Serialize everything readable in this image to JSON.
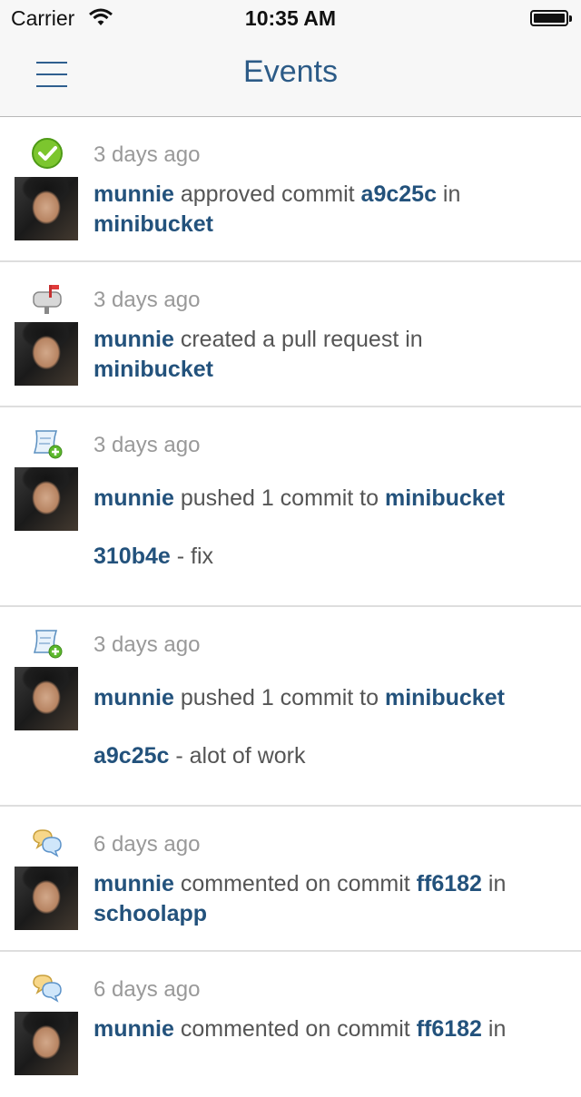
{
  "status_bar": {
    "carrier": "Carrier",
    "time": "10:35 AM"
  },
  "nav": {
    "title": "Events"
  },
  "events": [
    {
      "icon": "checkmark-icon",
      "time": "3 days ago",
      "user": "munnie",
      "action": " approved commit ",
      "target": "a9c25c",
      "joiner": " in",
      "repo": "minibucket"
    },
    {
      "icon": "mailbox-icon",
      "time": "3 days ago",
      "user": "munnie",
      "action": " created a pull request in",
      "repo": "minibucket"
    },
    {
      "icon": "scroll-add-icon",
      "time": "3 days ago",
      "user": "munnie",
      "action": " pushed 1 commit to ",
      "repo": "minibucket",
      "commit_hash": "310b4e",
      "commit_msg": " - fix"
    },
    {
      "icon": "scroll-add-icon",
      "time": "3 days ago",
      "user": "munnie",
      "action": " pushed 1 commit to ",
      "repo": "minibucket",
      "commit_hash": "a9c25c",
      "commit_msg": " - alot of work"
    },
    {
      "icon": "speech-bubbles-icon",
      "time": "6 days ago",
      "user": "munnie",
      "action": " commented on commit ",
      "target": "ff6182",
      "joiner": " in",
      "repo": "schoolapp"
    },
    {
      "icon": "speech-bubbles-icon",
      "time": "6 days ago",
      "user": "munnie",
      "action": " commented on commit ",
      "target": "ff6182",
      "joiner": " in"
    }
  ]
}
